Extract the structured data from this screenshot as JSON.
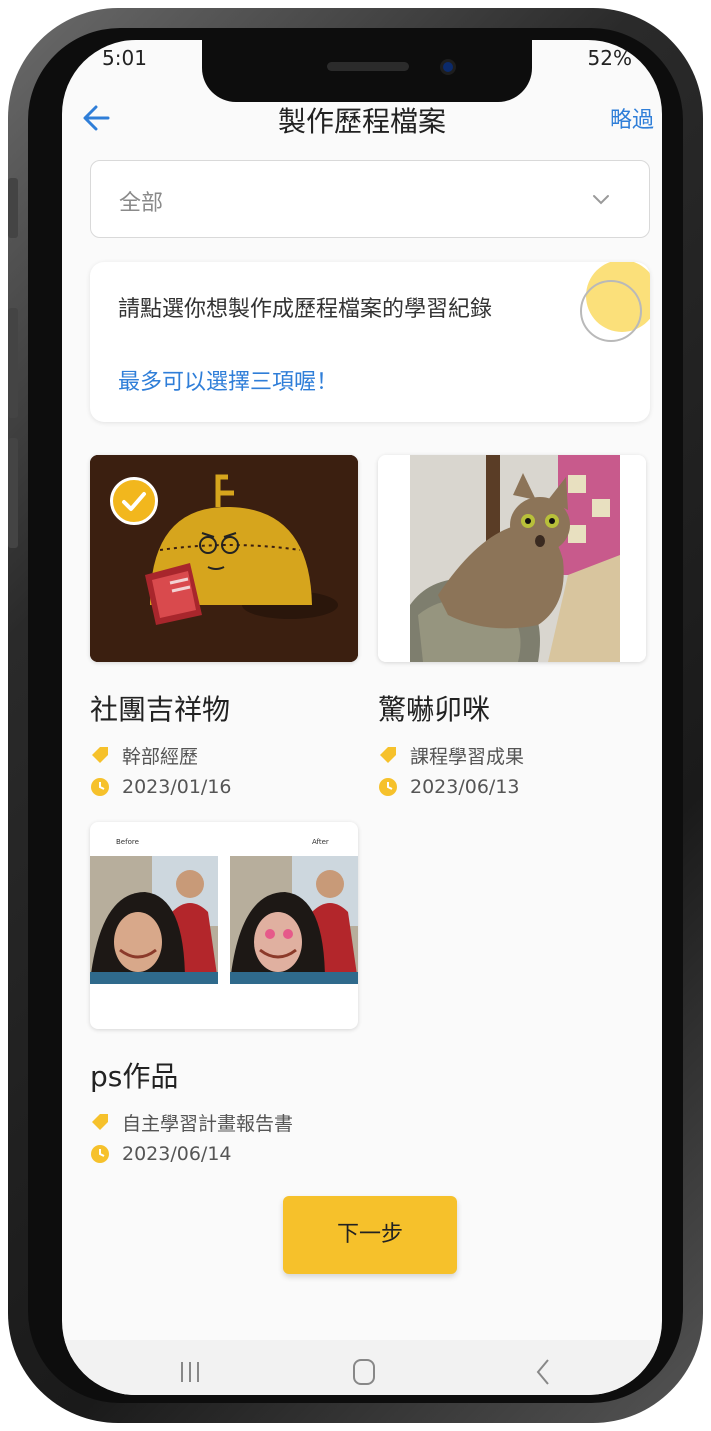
{
  "status_bar": {
    "left": "5:01",
    "right": "52%"
  },
  "header": {
    "title": "製作歷程檔案",
    "skip_label": "略過"
  },
  "filter": {
    "selected": "全部"
  },
  "info": {
    "line1": "請點選你想製作成歷程檔案的學習紀錄",
    "highlight": "最多可以選擇三項喔！"
  },
  "cards": [
    {
      "title": "社團吉祥物",
      "category": "幹部經歷",
      "date": "2023/01/16",
      "selected": true
    },
    {
      "title": "驚嚇卯咪",
      "category": "課程學習成果",
      "date": "2023/06/13",
      "selected": false
    },
    {
      "title": "ps作品",
      "category": "自主學習計畫報告書",
      "date": "2023/06/14",
      "selected": false,
      "thumb_labels": [
        "Before",
        "After"
      ]
    }
  ],
  "next_button": {
    "label": "下一步"
  },
  "colors": {
    "accent_blue": "#2f7ed8",
    "accent_yellow": "#f6c12b"
  },
  "icons": [
    "back-arrow-icon",
    "chevron-down-icon",
    "check-icon",
    "tag-icon",
    "clock-icon",
    "recents-icon",
    "home-icon",
    "back-icon"
  ]
}
